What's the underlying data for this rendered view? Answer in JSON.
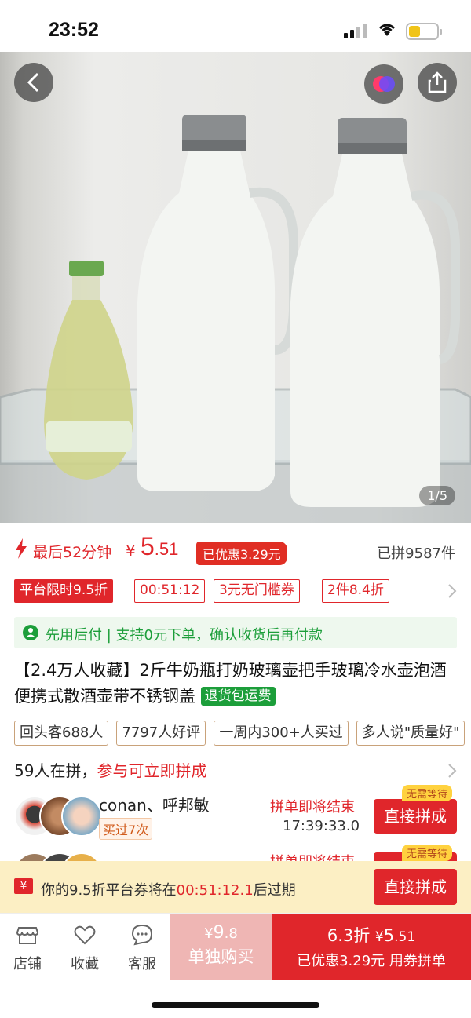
{
  "status": {
    "time": "23:52"
  },
  "hero": {
    "page_indicator": "1/5"
  },
  "price": {
    "last_minutes": "最后52分钟",
    "currency": "¥",
    "amount_int": "5",
    "amount_dec": ".51",
    "saved_tag": "已优惠3.29元",
    "sold": "已拼9587件"
  },
  "promos": [
    "平台限时9.5折",
    "00:51:12",
    "3元无门槛券",
    "2件8.4折"
  ],
  "pay_later": "先用后付 | 支持0元下单，确认收货后再付款",
  "product": {
    "title": "【2.4万人收藏】2斤牛奶瓶打奶玻璃壶把手玻璃冷水壶泡酒便携式散酒壶带不锈钢盖",
    "badge": "退货包运费"
  },
  "tags": [
    "回头客688人",
    "7797人好评",
    "一周内300+人买过",
    "多人说\"质量好\""
  ],
  "group": {
    "count_text": "59人在拼，",
    "cta_text": "参与可立即拼成",
    "items": [
      {
        "names": "conan、呼邦敏",
        "tag": "买过7次",
        "ending": "拼单即将结束",
        "countdown": "17:39:33.0",
        "button": "直接拼成",
        "badge": "无需等待"
      },
      {
        "names": "",
        "tag": "",
        "ending": "拼单即将结束",
        "countdown": "",
        "button": "直接拼成",
        "badge": "无需等待"
      }
    ]
  },
  "coupon_bar": {
    "prefix": "你的9.5折平台券将在",
    "time": "00:51:12.1",
    "suffix": "后过期",
    "button": "直接拼成",
    "icon": "¥"
  },
  "bottom": {
    "store": "店铺",
    "favorite": "收藏",
    "service": "客服",
    "single_currency": "¥",
    "single_int": "9",
    "single_dec": ".8",
    "single_label": "单独购买",
    "group_prefix": "6.3折",
    "group_currency": "¥",
    "group_int": "5",
    "group_dec": ".51",
    "group_label": "已优惠3.29元 用券拼单"
  },
  "colors": {
    "accent": "#e0262b",
    "green": "#1c9e3a",
    "coupon_bg": "#fcefc4"
  }
}
